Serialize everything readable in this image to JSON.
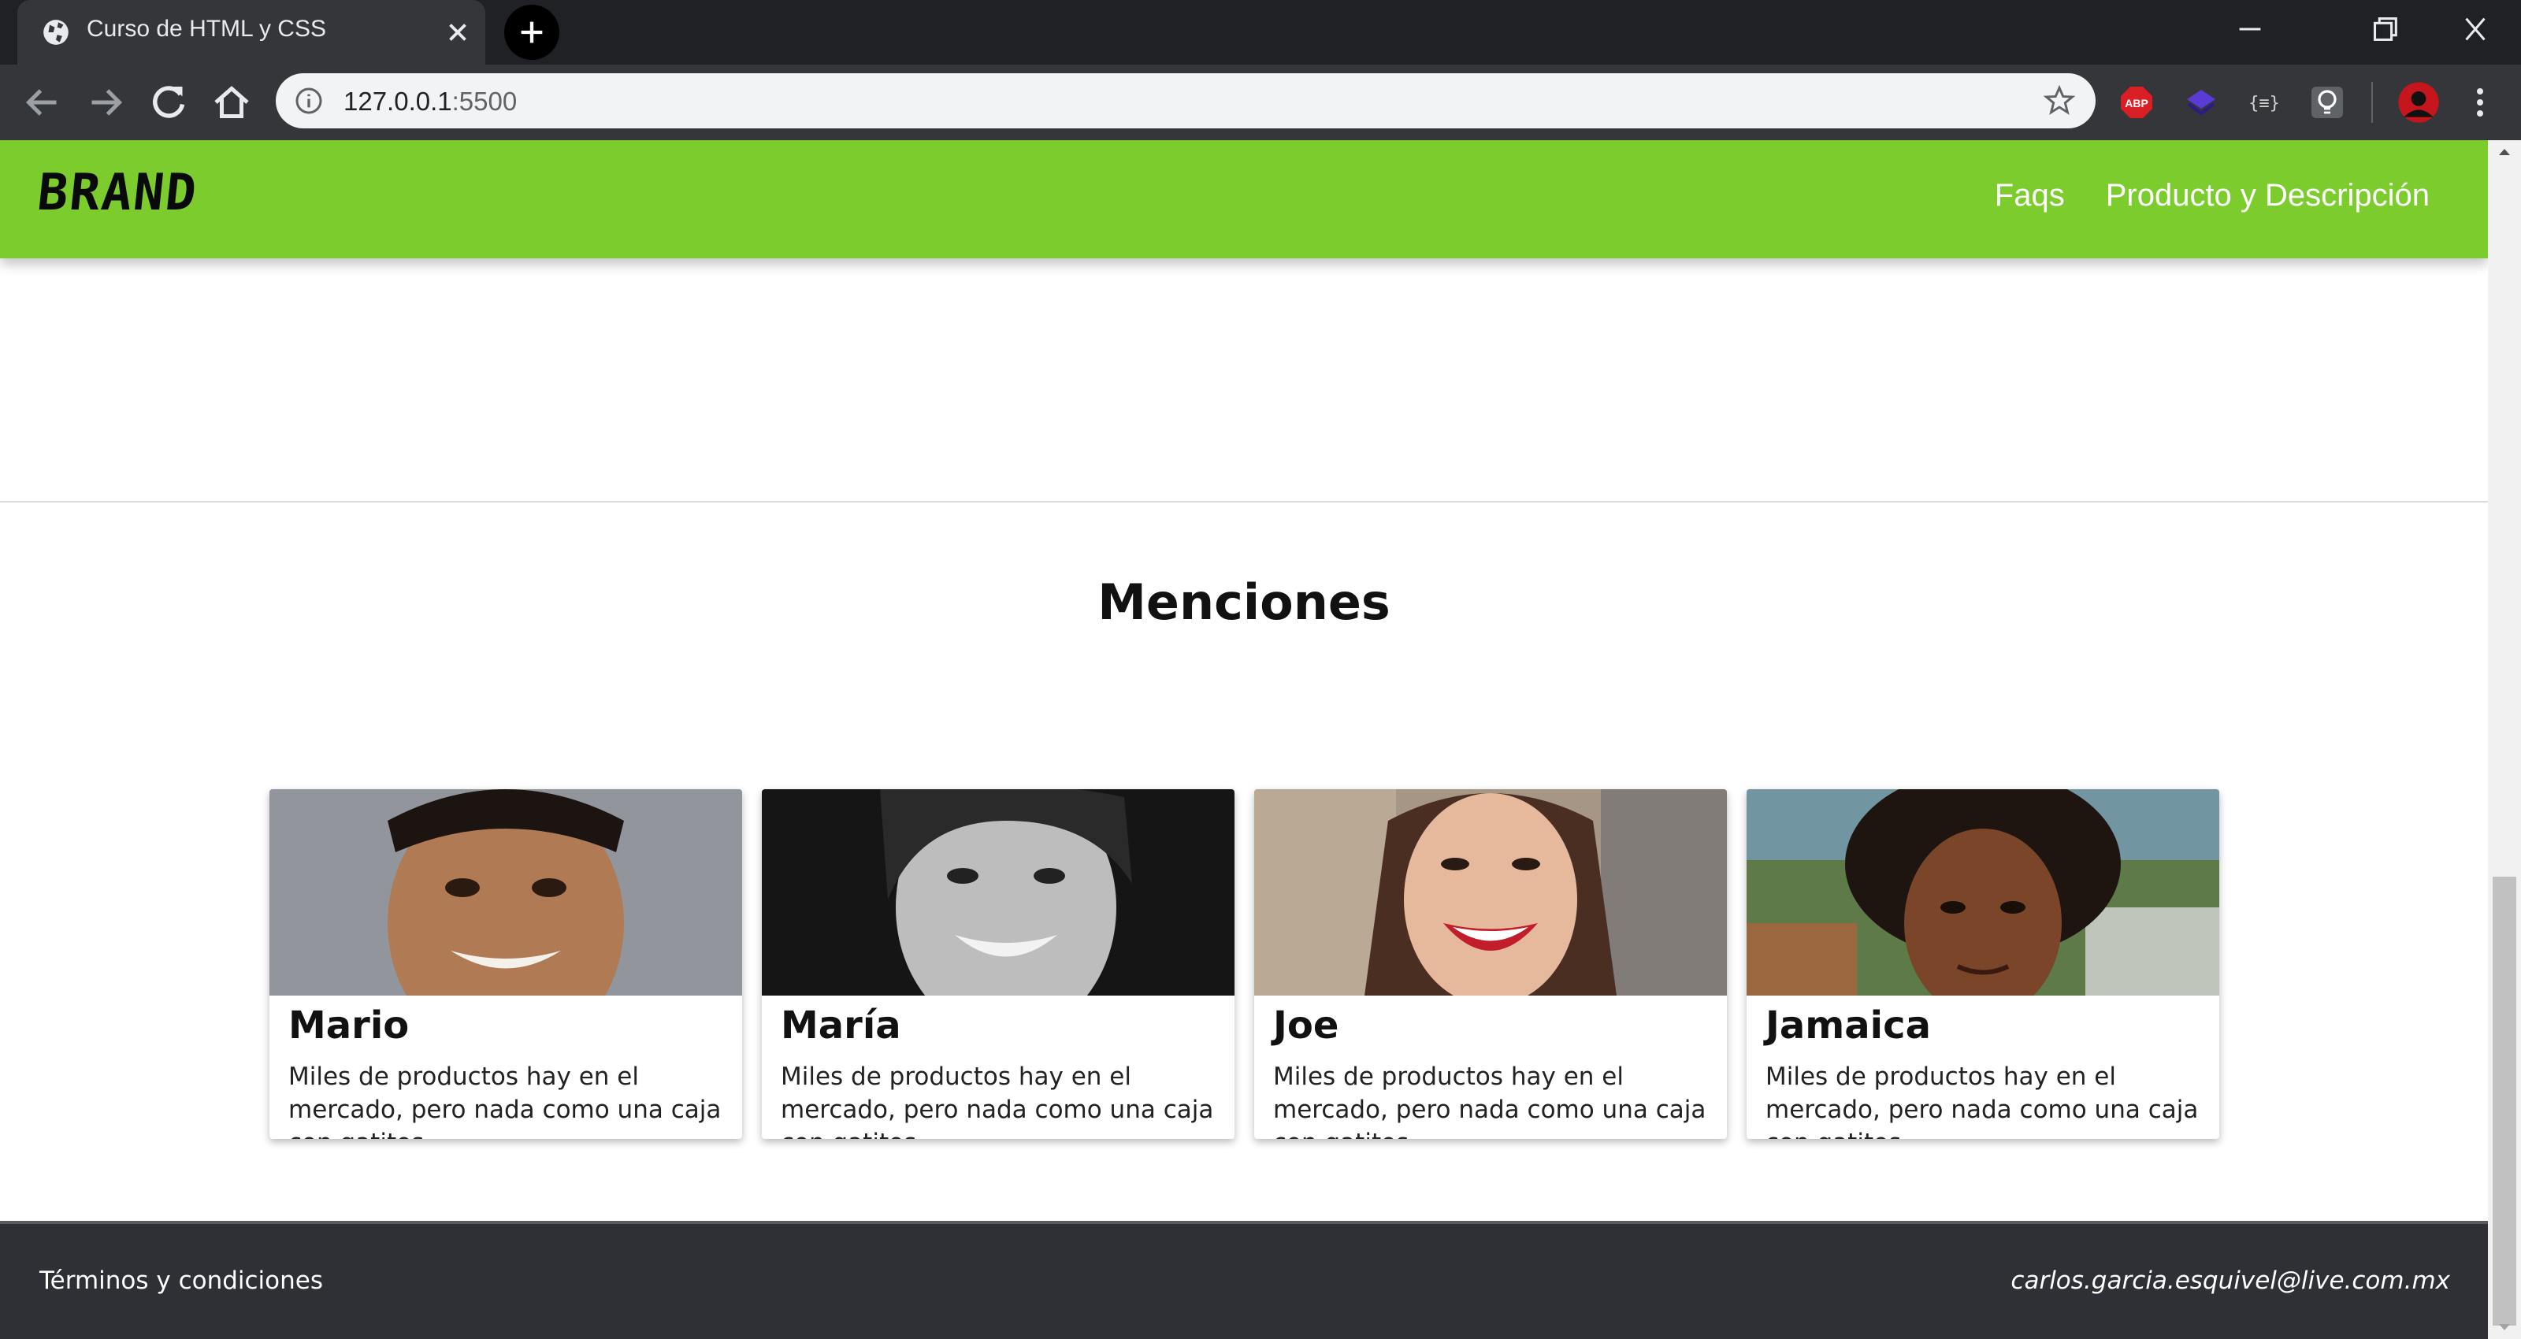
{
  "browser": {
    "tab_title": "Curso de HTML y CSS",
    "url_host": "127.0.0.1",
    "url_port": ":5500",
    "extensions": [
      "adblock-plus-icon",
      "layers-extension-icon",
      "json-viewer-icon",
      "lightbulb-extension-icon",
      "profile-avatar-icon"
    ],
    "ext_abp_label": "ABP"
  },
  "site": {
    "brand": "BRAND",
    "nav": [
      "Faqs",
      "Producto y Descripción"
    ]
  },
  "mentions": {
    "title": "Menciones",
    "cards": [
      {
        "name": "Mario",
        "desc": "Miles de productos hay en el mercado, pero nada como una caja con gatitos"
      },
      {
        "name": "María",
        "desc": "Miles de productos hay en el mercado, pero nada como una caja con gatitos"
      },
      {
        "name": "Joe",
        "desc": "Miles de productos hay en el mercado, pero nada como una caja con gatitos"
      },
      {
        "name": "Jamaica",
        "desc": "Miles de productos hay en el mercado, pero nada como una caja con gatitos"
      }
    ]
  },
  "footer": {
    "left": "Términos y condiciones",
    "right": "carlos.garcia.esquivel@live.com.mx"
  },
  "colors": {
    "navbar": "#7ccc2e",
    "footer": "#2f3035",
    "chrome_dark": "#202124"
  }
}
